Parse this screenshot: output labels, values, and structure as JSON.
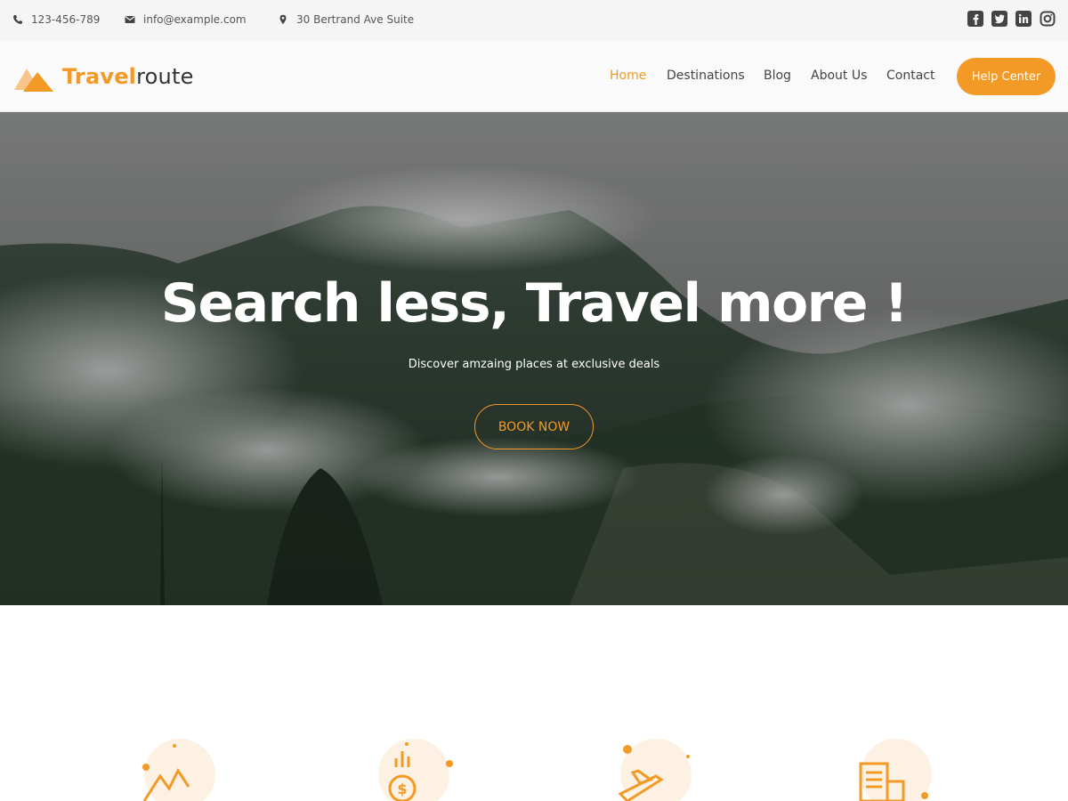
{
  "topbar": {
    "phone": "123-456-789",
    "email": "info@example.com",
    "address": "30 Bertrand Ave Suite",
    "icons": [
      "phone-icon",
      "mail-icon",
      "location-icon"
    ],
    "social": [
      "facebook-icon",
      "twitter-icon",
      "linkedin-icon",
      "instagram-icon"
    ]
  },
  "header": {
    "brand_part1": "Travel",
    "brand_part2": "route",
    "nav": [
      "Home",
      "Destinations",
      "Blog",
      "About Us",
      "Contact"
    ],
    "active_nav": "Home",
    "cta": "Help Center"
  },
  "hero": {
    "title": "Search less, Travel more !",
    "subtitle": "Discover amzaing places at exclusive deals",
    "button": "BOOK NOW"
  },
  "features": {
    "icons": [
      "mountains-icon",
      "money-growth-icon",
      "airplane-icon",
      "buildings-icon"
    ]
  },
  "colors": {
    "accent": "#f39a26",
    "topbar_bg": "#f5f5f5",
    "header_bg": "#fafafa",
    "icon_circle": "#fdf1e3"
  }
}
